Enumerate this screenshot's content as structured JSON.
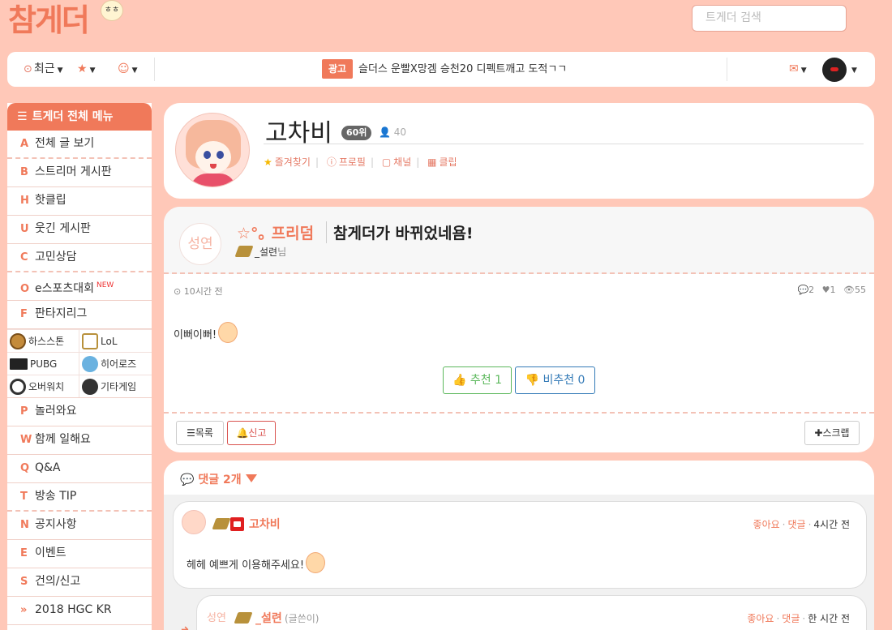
{
  "logo": {
    "text": "참게더",
    "badge": "ㅎㅎ"
  },
  "search": {
    "placeholder": "트게더 검색"
  },
  "topbar": {
    "recent_label": "최근",
    "clock_icon": "⊙",
    "star_icon": "★",
    "smile_icon": "☺",
    "ad_label": "광고",
    "ad_text": "슬더스 운빨X망겜 승천20 디펙트깨고 도적ㄱㄱ",
    "mail_icon": "✉"
  },
  "sidebar": {
    "header": "트게더 전체 메뉴",
    "items_top": [
      {
        "letter": "A",
        "label": "전체 글 보기"
      },
      {
        "letter": "B",
        "label": "스트리머 게시판"
      },
      {
        "letter": "H",
        "label": "핫클립"
      },
      {
        "letter": "U",
        "label": "웃긴 게시판"
      },
      {
        "letter": "C",
        "label": "고민상담"
      },
      {
        "letter": "O",
        "label": "e스포츠대회",
        "new": "NEW"
      },
      {
        "letter": "F",
        "label": "판타지리그"
      }
    ],
    "games": [
      "하스스톤",
      "LoL",
      "PUBG",
      "히어로즈",
      "오버워치",
      "기타게임"
    ],
    "pubg_mark": "PUBG",
    "items_bottom": [
      {
        "letter": "P",
        "label": "놀러와요"
      },
      {
        "letter": "W",
        "label": "함께 일해요"
      },
      {
        "letter": "Q",
        "label": "Q&A"
      },
      {
        "letter": "T",
        "label": "방송 TIP"
      },
      {
        "letter": "N",
        "label": "공지사항"
      },
      {
        "letter": "E",
        "label": "이벤트"
      },
      {
        "letter": "S",
        "label": "건의/신고"
      },
      {
        "letter": "»",
        "label": "2018 HGC KR"
      }
    ]
  },
  "profile": {
    "name": "고차비",
    "rank": "60위",
    "fans": "40",
    "links": [
      "즐겨찾기",
      "프로필",
      "채널",
      "클립"
    ]
  },
  "post": {
    "avatar_text": "성연",
    "category": "☆°｡ 프리덤",
    "title": "참게더가 바뀌었네욤!",
    "author": "_설련",
    "author_suffix": "님",
    "time": "10시간 전",
    "comments": "2",
    "likes": "1",
    "views": "55",
    "body": "이뻐이뻐!",
    "upvote_label": "추천",
    "upvote_count": "1",
    "downvote_label": "비추천",
    "downvote_count": "0",
    "list_label": "목록",
    "report_label": "신고",
    "scrap_label": "스크랩"
  },
  "comments": {
    "title": "댓글 2개",
    "items": [
      {
        "name": "고차비",
        "like": "좋아요",
        "reply": "댓글",
        "time": "4시간 전",
        "text": "헤헤 예쁘게 이용해주세요!"
      },
      {
        "ghost": "성연",
        "name": "_설련",
        "writer": "(글쓴이)",
        "like": "좋아요",
        "reply": "댓글",
        "time": "한 시간 전"
      }
    ]
  },
  "colors": {
    "accent": "#f0795a",
    "background": "#ffc8b8",
    "upvote": "#5cb85c",
    "downvote": "#337ab7"
  }
}
